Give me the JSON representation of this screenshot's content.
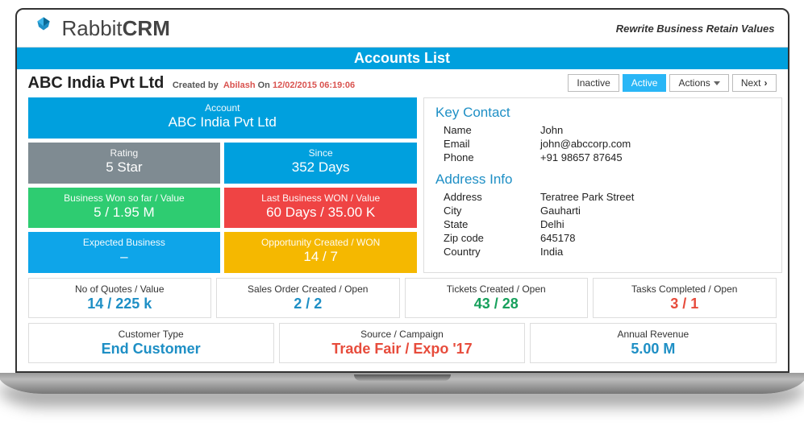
{
  "brand": {
    "name1": "Rabbit",
    "name2": "CRM",
    "tagline": "Rewrite Business Retain Values"
  },
  "page_title": "Accounts List",
  "account": {
    "name": "ABC India Pvt Ltd",
    "created_label": "Created by",
    "created_by": "Abilash",
    "on_label": "On",
    "created_on": "12/02/2015 06:19:06"
  },
  "buttons": {
    "inactive": "Inactive",
    "active": "Active",
    "actions": "Actions",
    "next": "Next"
  },
  "tiles": {
    "account_lbl": "Account",
    "account_val": "ABC India Pvt Ltd",
    "rating_lbl": "Rating",
    "rating_val": "5 Star",
    "since_lbl": "Since",
    "since_val": "352 Days",
    "won_lbl": "Business Won so far / Value",
    "won_val": "5 / 1.95 M",
    "last_lbl": "Last Business WON / Value",
    "last_val": "60 Days / 35.00 K",
    "exp_lbl": "Expected Business",
    "exp_val": "–",
    "opp_lbl": "Opportunity Created / WON",
    "opp_val": "14 / 7"
  },
  "contact": {
    "heading": "Key Contact",
    "name_lbl": "Name",
    "name": "John",
    "email_lbl": "Email",
    "email": "john@abccorp.com",
    "phone_lbl": "Phone",
    "phone": "+91 98657 87645"
  },
  "address": {
    "heading": "Address Info",
    "address_lbl": "Address",
    "address": "Teratree Park Street",
    "city_lbl": "City",
    "city": "Gauharti",
    "state_lbl": "State",
    "state": "Delhi",
    "zip_lbl": "Zip code",
    "zip": "645178",
    "country_lbl": "Country",
    "country": "India"
  },
  "stats4": {
    "quotes_lbl": "No of Quotes / Value",
    "quotes_val": "14 / 225 k",
    "so_lbl": "Sales Order Created / Open",
    "so_val": "2 / 2",
    "tickets_lbl": "Tickets Created / Open",
    "tickets_val": "43 / 28",
    "tasks_lbl": "Tasks Completed / Open",
    "tasks_val": "3 / 1"
  },
  "stats3": {
    "cust_lbl": "Customer Type",
    "cust_val": "End Customer",
    "src_lbl": "Source / Campaign",
    "src_val": "Trade Fair / Expo '17",
    "rev_lbl": "Annual Revenue",
    "rev_val": "5.00 M"
  }
}
